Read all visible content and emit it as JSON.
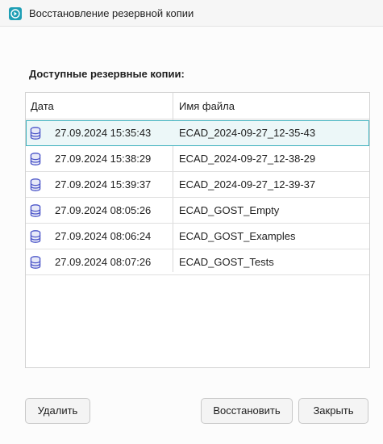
{
  "window": {
    "title": "Восстановление резервной копии",
    "accent_color": "#1e9fb5"
  },
  "section": {
    "label": "Доступные резервные копии:"
  },
  "table": {
    "columns": [
      "Дата",
      "Имя файла"
    ],
    "rows": [
      {
        "date": "27.09.2024 15:35:43",
        "file": "ECAD_2024-09-27_12-35-43",
        "selected": true
      },
      {
        "date": "27.09.2024 15:38:29",
        "file": "ECAD_2024-09-27_12-38-29",
        "selected": false
      },
      {
        "date": "27.09.2024 15:39:37",
        "file": "ECAD_2024-09-27_12-39-37",
        "selected": false
      },
      {
        "date": "27.09.2024 08:05:26",
        "file": "ECAD_GOST_Empty",
        "selected": false
      },
      {
        "date": "27.09.2024 08:06:24",
        "file": "ECAD_GOST_Examples",
        "selected": false
      },
      {
        "date": "27.09.2024 08:07:26",
        "file": "ECAD_GOST_Tests",
        "selected": false
      }
    ],
    "row_icon": "database-icon",
    "selection_color": "#3eb1be"
  },
  "buttons": {
    "delete": "Удалить",
    "restore": "Восстановить",
    "close": "Закрыть"
  }
}
